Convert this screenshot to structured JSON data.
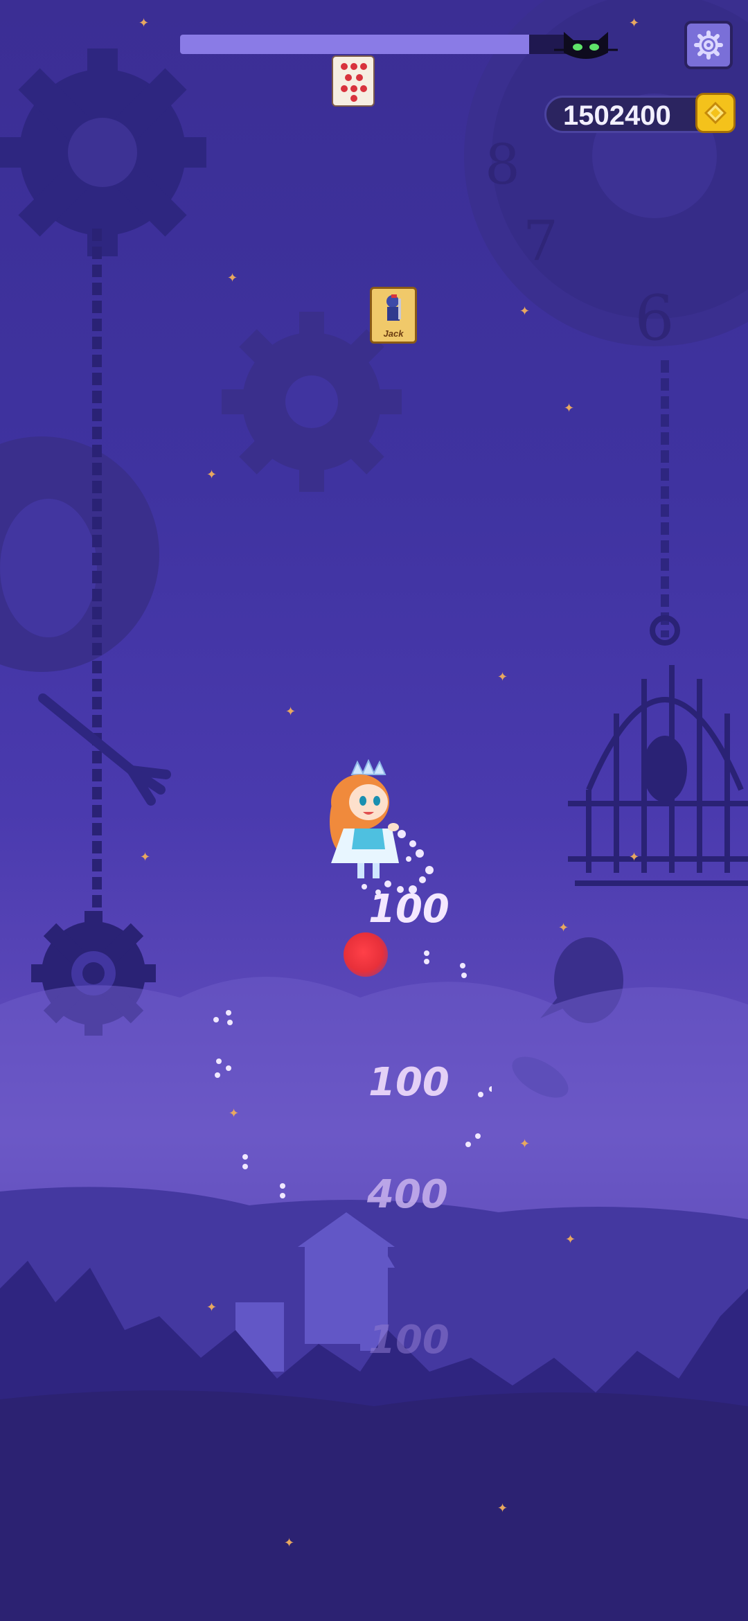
{
  "hud": {
    "progress": 0.9,
    "score": "1502400",
    "settings_icon": "gear-icon",
    "coin_icon": "coin-icon",
    "cat_icon": "black-cat-icon"
  },
  "cards": {
    "top_card": "hearts-card",
    "jack_label": "Jack"
  },
  "popups": [
    "100",
    "100",
    "400",
    "100"
  ],
  "colors": {
    "progress_fill": "#8a7be6",
    "coin": "#f4c21b",
    "ball": "#e8303a",
    "settings_bg": "#7a6fd8"
  }
}
